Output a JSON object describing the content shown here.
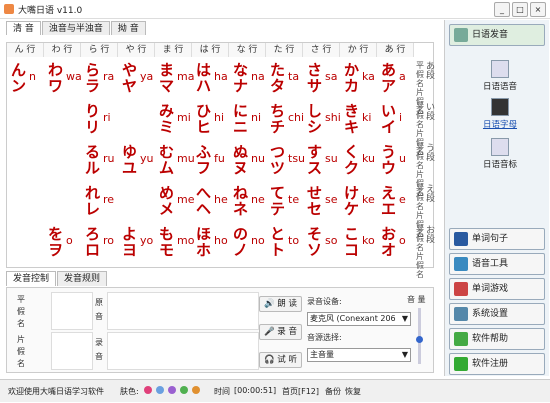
{
  "window": {
    "title": "大嘴日语 v11.0"
  },
  "tabs": [
    "清 音",
    "浊音与半浊音",
    "拗 音"
  ],
  "columns": [
    "ん 行",
    "わ 行",
    "ら 行",
    "や 行",
    "ま 行",
    "は 行",
    "な 行",
    "た 行",
    "さ 行",
    "か 行",
    "あ 行"
  ],
  "rows": [
    [
      [
        "ん",
        "ン",
        "n"
      ],
      [
        "わ",
        "ワ",
        "wa"
      ],
      [
        "ら",
        "ラ",
        "ra"
      ],
      [
        "や",
        "ヤ",
        "ya"
      ],
      [
        "ま",
        "マ",
        "ma"
      ],
      [
        "は",
        "ハ",
        "ha"
      ],
      [
        "な",
        "ナ",
        "na"
      ],
      [
        "た",
        "タ",
        "ta"
      ],
      [
        "さ",
        "サ",
        "sa"
      ],
      [
        "か",
        "カ",
        "ka"
      ],
      [
        "あ",
        "ア",
        "a"
      ]
    ],
    [
      null,
      null,
      [
        "り",
        "リ",
        "ri"
      ],
      null,
      [
        "み",
        "ミ",
        "mi"
      ],
      [
        "ひ",
        "ヒ",
        "hi"
      ],
      [
        "に",
        "ニ",
        "ni"
      ],
      [
        "ち",
        "チ",
        "chi"
      ],
      [
        "し",
        "シ",
        "shi"
      ],
      [
        "き",
        "キ",
        "ki"
      ],
      [
        "い",
        "イ",
        "i"
      ]
    ],
    [
      null,
      null,
      [
        "る",
        "ル",
        "ru"
      ],
      [
        "ゆ",
        "ユ",
        "yu"
      ],
      [
        "む",
        "ム",
        "mu"
      ],
      [
        "ふ",
        "フ",
        "fu"
      ],
      [
        "ぬ",
        "ヌ",
        "nu"
      ],
      [
        "つ",
        "ツ",
        "tsu"
      ],
      [
        "す",
        "ス",
        "su"
      ],
      [
        "く",
        "ク",
        "ku"
      ],
      [
        "う",
        "ウ",
        "u"
      ]
    ],
    [
      null,
      null,
      [
        "れ",
        "レ",
        "re"
      ],
      null,
      [
        "め",
        "メ",
        "me"
      ],
      [
        "へ",
        "ヘ",
        "he"
      ],
      [
        "ね",
        "ネ",
        "ne"
      ],
      [
        "て",
        "テ",
        "te"
      ],
      [
        "せ",
        "セ",
        "se"
      ],
      [
        "け",
        "ケ",
        "ke"
      ],
      [
        "え",
        "エ",
        "e"
      ]
    ],
    [
      null,
      [
        "を",
        "ヲ",
        "o"
      ],
      [
        "ろ",
        "ロ",
        "ro"
      ],
      [
        "よ",
        "ヨ",
        "yo"
      ],
      [
        "も",
        "モ",
        "mo"
      ],
      [
        "ほ",
        "ホ",
        "ho"
      ],
      [
        "の",
        "ノ",
        "no"
      ],
      [
        "と",
        "ト",
        "to"
      ],
      [
        "そ",
        "ソ",
        "so"
      ],
      [
        "こ",
        "コ",
        "ko"
      ],
      [
        "お",
        "オ",
        "o"
      ]
    ]
  ],
  "row_labels": [
    {
      "side": "平假名片假名",
      "dan": "あ 段"
    },
    {
      "side": "平假名片假名",
      "dan": "い 段"
    },
    {
      "side": "平假名片假名",
      "dan": "う 段"
    },
    {
      "side": "平假名片假名",
      "dan": "え 段"
    },
    {
      "side": "平假名片假名",
      "dan": "お 段"
    }
  ],
  "bottom_tabs": [
    "发音控制",
    "发音规则"
  ],
  "control": {
    "hira_label": "平\n假\n名",
    "kata_label": "片\n假\n名",
    "src_label": "原\n音",
    "rec_label": "录\n音",
    "read_btn": "朗 读",
    "rec_btn": "录 音",
    "try_btn": "试 听",
    "device_label": "录音设备:",
    "device_value": "麦克风 (Conexant 206",
    "source_label": "音源选择:",
    "source_value": "主音量",
    "volume_label": "音 量"
  },
  "status": {
    "welcome": "欢迎使用大嘴日语学习软件",
    "skin": "肤色:",
    "time_label": "时间",
    "time_value": "[00:00:51]",
    "home": "首页[F12]",
    "backup": "备份",
    "restore": "恢复"
  },
  "sidebar": {
    "top": "日语发音",
    "nav": [
      "日语语音",
      "日语字母",
      "日语音标"
    ],
    "buttons": [
      "单词句子",
      "语音工具",
      "单词游戏",
      "系统设置",
      "软件帮助",
      "软件注册"
    ]
  },
  "colors": {
    "kana": "#b00000",
    "skin_dots": [
      "#e0407a",
      "#6aa0e0",
      "#9a60d0",
      "#50b050",
      "#e09030"
    ]
  }
}
